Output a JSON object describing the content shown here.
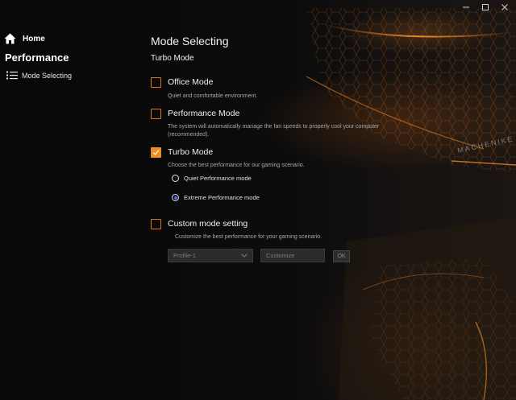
{
  "window": {
    "controls": [
      {
        "name": "minimize",
        "glyph": "—"
      },
      {
        "name": "maximize",
        "glyph": "☐"
      },
      {
        "name": "close",
        "glyph": "✕"
      }
    ]
  },
  "sidebar": {
    "home_label": "Home",
    "section_title": "Performance",
    "items": [
      {
        "label": "Mode Selecting",
        "icon": "list-icon"
      }
    ]
  },
  "main": {
    "page_title": "Mode Selecting",
    "section_title": "Turbo Mode",
    "modes": [
      {
        "label": "Office Mode",
        "checked": false,
        "description": "Quiet and comfortable environment."
      },
      {
        "label": "Performance Mode",
        "checked": false,
        "description_line1": "The system will automatically manage the fan speeds to properly cool your computer",
        "description_line2": "(recommended)."
      },
      {
        "label": "Turbo Mode",
        "checked": true,
        "description": "Choose the best performance for our gaming scenario."
      },
      {
        "label": "Custom mode setting",
        "checked": false,
        "description": "Customize the best performance for your gaming scenario."
      }
    ],
    "turbo_options": [
      {
        "label": "Quiet Performance mode",
        "selected": false
      },
      {
        "label": "Extreme Performance mode",
        "selected": true
      }
    ],
    "custom": {
      "profile_value": "Profile-1",
      "customize_placeholder": "Customize",
      "ok_label": "OK"
    }
  },
  "background": {
    "brand_text": "MACHENIKE"
  },
  "colors": {
    "accent": "#f08a22",
    "background": "#0b0b0b",
    "text": "#f0f0f0",
    "muted_text": "#a8a8a8"
  }
}
